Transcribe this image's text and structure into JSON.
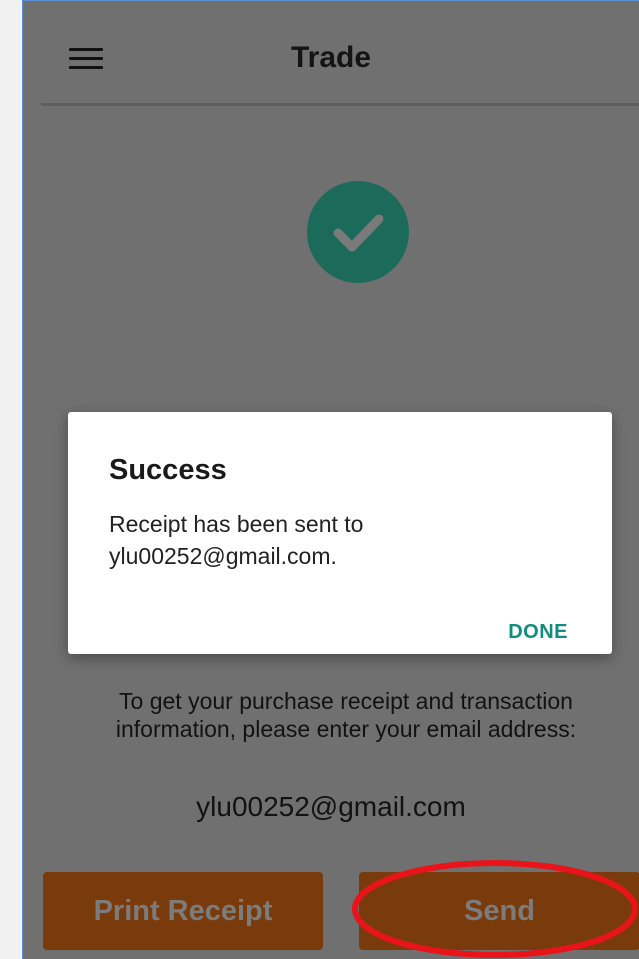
{
  "header": {
    "title": "Trade",
    "menu_icon": "hamburger-menu-icon"
  },
  "status": {
    "icon": "checkmark-circle-icon",
    "color": "#1c6a5a"
  },
  "receipt": {
    "instruction_line1": "To get your purchase receipt and transaction",
    "instruction_line2": "information, please enter your email address:",
    "email": "ylu00252@gmail.com"
  },
  "actions": {
    "print_label": "Print Receipt",
    "send_label": "Send",
    "button_color": "#7a3b0c"
  },
  "dialog": {
    "title": "Success",
    "message_line1": "Receipt has been sent to",
    "message_line2": "ylu00252@gmail.com.",
    "done_label": "DONE",
    "done_color": "#128c7e"
  },
  "annotation": {
    "highlight_color": "#e8141a"
  }
}
